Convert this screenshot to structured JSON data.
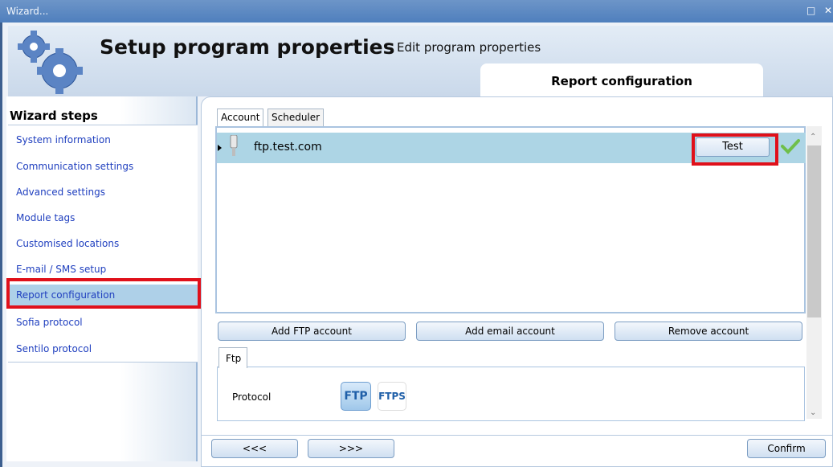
{
  "window": {
    "title": "Wizard...",
    "maximize_icon": "maximize-icon",
    "close_icon": "close-icon"
  },
  "header": {
    "title": "Setup program properties",
    "subtitle": "Edit program properties",
    "active_section": "Report configuration",
    "icon": "gears-icon"
  },
  "sidebar": {
    "title": "Wizard steps",
    "items": [
      {
        "label": "System information"
      },
      {
        "label": "Communication settings"
      },
      {
        "label": "Advanced settings"
      },
      {
        "label": "Module tags"
      },
      {
        "label": "Customised locations"
      },
      {
        "label": "E-mail / SMS setup"
      },
      {
        "label": "Report configuration",
        "active": true
      },
      {
        "label": "Sofia protocol"
      },
      {
        "label": "Sentilo protocol"
      }
    ]
  },
  "tabs": [
    {
      "label": "Account",
      "active": true
    },
    {
      "label": "Scheduler"
    }
  ],
  "accounts": [
    {
      "name": "ftp.test.com",
      "test_label": "Test",
      "status": "check-icon"
    }
  ],
  "actions": {
    "add_ftp": "Add FTP account",
    "add_email": "Add email account",
    "remove": "Remove account"
  },
  "detail": {
    "tab": "Ftp",
    "protocol_label": "Protocol",
    "protocol_options": [
      "FTP",
      "FTPS"
    ],
    "selected_protocol": "FTP"
  },
  "nav": {
    "prev": "<<<",
    "next": ">>>",
    "confirm": "Confirm"
  },
  "colors": {
    "titlebar": "#4f7fbd",
    "selection": "#add5e5",
    "highlight": "#e0101a",
    "link": "#1f3fbf"
  }
}
